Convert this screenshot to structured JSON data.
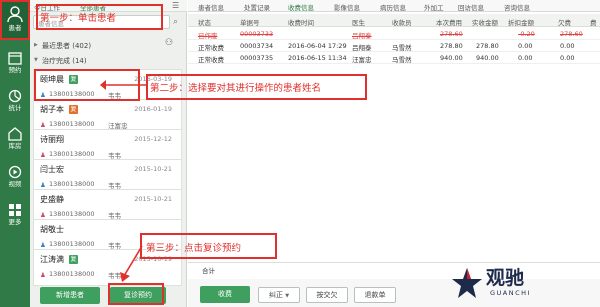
{
  "nav": {
    "items": [
      {
        "label": "患者",
        "icon": "person-icon"
      },
      {
        "label": "预约",
        "icon": "calendar-icon"
      },
      {
        "label": "统计",
        "icon": "chart-icon"
      },
      {
        "label": "库房",
        "icon": "warehouse-icon"
      },
      {
        "label": "视频",
        "icon": "video-icon"
      },
      {
        "label": "更多",
        "icon": "more-icon"
      }
    ]
  },
  "list": {
    "tabs": [
      "今日工作",
      "全部患者"
    ],
    "search_placeholder": "患者信息",
    "recent_section": "最近患者 (402)",
    "treating_section": "治疗完成 (14)",
    "patients": [
      {
        "name": "颐坤晨",
        "badge": "复",
        "badge_color": "#3f9f5e",
        "date": "2016-03-19",
        "phone": "13800138000",
        "doctor": "韦韦",
        "gender_icon": "male-icon"
      },
      {
        "name": "胡子本",
        "badge": "复",
        "badge_color": "#e0712b",
        "date": "2016-01-19",
        "phone": "13800138000",
        "doctor": "汪富忠",
        "gender_icon": "female-icon"
      },
      {
        "name": "诗丽翔",
        "badge": "",
        "badge_color": "",
        "date": "2015-12-12",
        "phone": "13800138000",
        "doctor": "韦韦",
        "gender_icon": "female-icon"
      },
      {
        "name": "闫士宏",
        "badge": "",
        "badge_color": "",
        "date": "2015-10-21",
        "phone": "13800138000",
        "doctor": "韦韦",
        "gender_icon": "male-icon"
      },
      {
        "name": "史盛静",
        "badge": "",
        "badge_color": "",
        "date": "2015-10-21",
        "phone": "13800138000",
        "doctor": "韦韦",
        "gender_icon": "female-icon"
      },
      {
        "name": "胡敬士",
        "badge": "",
        "badge_color": "",
        "date": "",
        "phone": "13800138000",
        "doctor": "韦韦",
        "gender_icon": "male-icon"
      },
      {
        "name": "江涛满",
        "badge": "复",
        "badge_color": "#3f9f5e",
        "date": "2015-10-19",
        "phone": "13800138000",
        "doctor": "韦韦",
        "gender_icon": "female-icon"
      }
    ],
    "add_button": "新增患者",
    "revisit_button": "复诊预约"
  },
  "main": {
    "tabs": [
      "患者信息",
      "处置记录",
      "收费信息",
      "影像信息",
      "病历信息",
      "外加工",
      "回访信息",
      "咨询信息"
    ],
    "columns": [
      "状态",
      "单据号",
      "收费时间",
      "医生",
      "收款员",
      "本次费用",
      "实收金额",
      "折扣金额",
      "欠费",
      "费"
    ],
    "rows": [
      {
        "status": "已作废",
        "doc_no": "00003733",
        "time": "",
        "doctor": "吕翔泰",
        "cashier": "",
        "fee": "278.60",
        "received": "",
        "discount": "-0.20",
        "debt": "278.60",
        "mark": "",
        "strike": true
      },
      {
        "status": "正常收费",
        "doc_no": "00003734",
        "time": "2016-06-04 17:29",
        "doctor": "吕翔泰",
        "cashier": "马雪然",
        "fee": "278.80",
        "received": "278.80",
        "discount": "0.00",
        "debt": "0.00",
        "mark": "",
        "strike": false
      },
      {
        "status": "正常收费",
        "doc_no": "00003735",
        "time": "2016-06-15 11:34",
        "doctor": "汪富忠",
        "cashier": "马雪然",
        "fee": "940.00",
        "received": "940.00",
        "discount": "0.00",
        "debt": "0.00",
        "mark": "",
        "strike": false
      }
    ],
    "total_label": "合计",
    "buttons": {
      "charge": "收费",
      "correct": "纠正",
      "refund": "按交欠",
      "return": "退款单"
    }
  },
  "annotations": {
    "step1": "第一步：单击患者",
    "step2": "第二步：选择要对其进行操作的患者姓名",
    "step3": "第三步：点击复诊预约"
  },
  "watermark": {
    "cn": "观驰",
    "en": "GUANCHI"
  }
}
